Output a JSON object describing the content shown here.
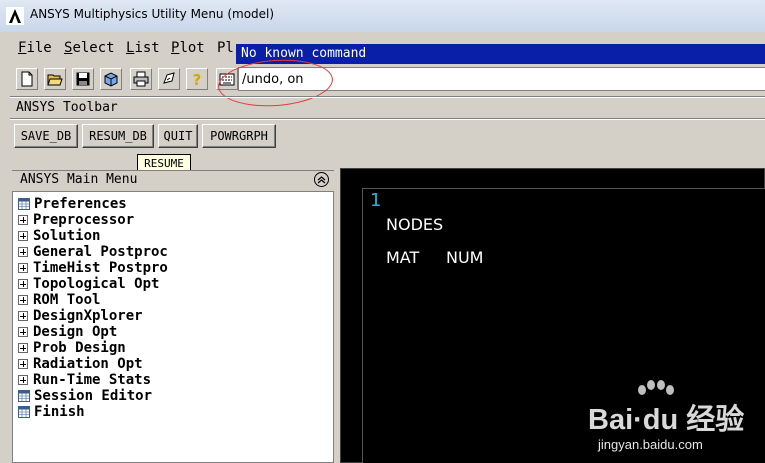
{
  "window": {
    "title": "ANSYS Multiphysics Utility Menu (model)"
  },
  "menubar": {
    "items": [
      {
        "label": "File",
        "key": "F"
      },
      {
        "label": "Select",
        "key": "S"
      },
      {
        "label": "List",
        "key": "L"
      },
      {
        "label": "Plot",
        "key": "P"
      },
      {
        "label": "Pl",
        "key": ""
      }
    ]
  },
  "command": {
    "message": "No known command",
    "value": "/undo, on"
  },
  "toolbar": {
    "label": "ANSYS Toolbar",
    "buttons": [
      "SAVE_DB",
      "RESUM_DB",
      "QUIT",
      "POWRGRPH"
    ],
    "tooltip": "RESUME"
  },
  "main_menu": {
    "title": "ANSYS Main Menu",
    "items": [
      {
        "label": "Preferences",
        "icon": "table-icon"
      },
      {
        "label": "Preprocessor",
        "icon": "expand-icon"
      },
      {
        "label": "Solution",
        "icon": "expand-icon"
      },
      {
        "label": "General Postproc",
        "icon": "expand-icon"
      },
      {
        "label": "TimeHist Postpro",
        "icon": "expand-icon"
      },
      {
        "label": "Topological Opt",
        "icon": "expand-icon"
      },
      {
        "label": "ROM Tool",
        "icon": "expand-icon"
      },
      {
        "label": "DesignXplorer",
        "icon": "expand-icon"
      },
      {
        "label": "Design Opt",
        "icon": "expand-icon"
      },
      {
        "label": "Prob Design",
        "icon": "expand-icon"
      },
      {
        "label": "Radiation Opt",
        "icon": "expand-icon"
      },
      {
        "label": "Run-Time Stats",
        "icon": "expand-icon"
      },
      {
        "label": "Session Editor",
        "icon": "table-icon"
      },
      {
        "label": "Finish",
        "icon": "table-icon"
      }
    ]
  },
  "graphics": {
    "window_number": "1",
    "line1": "NODES",
    "line2a": "MAT",
    "line2b": "NUM"
  },
  "watermark": {
    "text": "Bai·du 经验",
    "url": "jingyan.baidu.com"
  },
  "colors": {
    "message_bar": "#0a1fa8",
    "highlight": "#e43a3a",
    "graphics_bg": "#000000",
    "window_number": "#28b4d8"
  }
}
